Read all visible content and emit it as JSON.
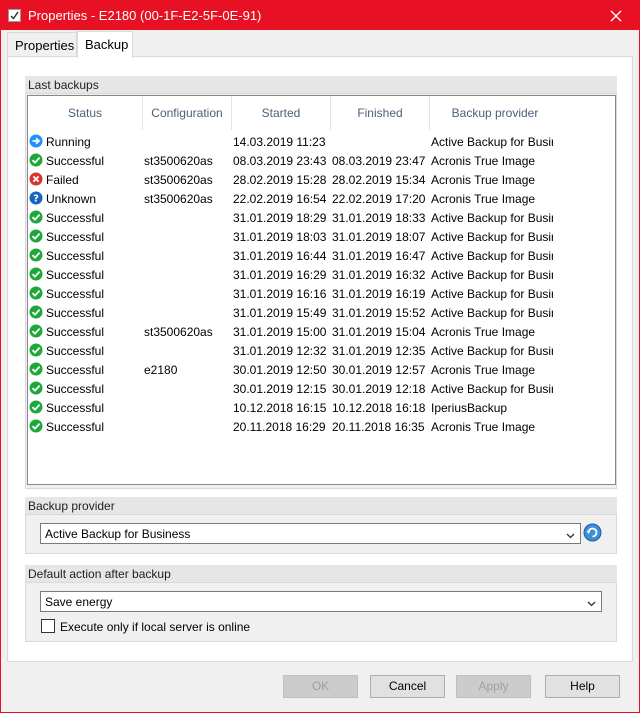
{
  "window": {
    "title": "Properties - E2180 (00-1F-E2-5F-0E-91)"
  },
  "tabs": [
    {
      "label": "Properties"
    },
    {
      "label": "Backup"
    }
  ],
  "last_backups": {
    "header": "Last backups",
    "columns": [
      "Status",
      "Configuration",
      "Started",
      "Finished",
      "Backup provider"
    ],
    "rows": [
      {
        "status": "Running",
        "status_icon": "running-icon",
        "config": "",
        "started": "14.03.2019 11:23",
        "finished": "",
        "provider": "Active Backup for Busine"
      },
      {
        "status": "Successful",
        "status_icon": "success-icon",
        "config": "st3500620as",
        "started": "08.03.2019 23:43",
        "finished": "08.03.2019 23:47",
        "provider": "Acronis True Image"
      },
      {
        "status": "Failed",
        "status_icon": "failed-icon",
        "config": "st3500620as",
        "started": "28.02.2019 15:28",
        "finished": "28.02.2019 15:34",
        "provider": "Acronis True Image"
      },
      {
        "status": "Unknown",
        "status_icon": "unknown-icon",
        "config": "st3500620as",
        "started": "22.02.2019 16:54",
        "finished": "22.02.2019 17:20",
        "provider": "Acronis True Image"
      },
      {
        "status": "Successful",
        "status_icon": "success-icon",
        "config": "",
        "started": "31.01.2019 18:29",
        "finished": "31.01.2019 18:33",
        "provider": "Active Backup for Busine"
      },
      {
        "status": "Successful",
        "status_icon": "success-icon",
        "config": "",
        "started": "31.01.2019 18:03",
        "finished": "31.01.2019 18:07",
        "provider": "Active Backup for Busine"
      },
      {
        "status": "Successful",
        "status_icon": "success-icon",
        "config": "",
        "started": "31.01.2019 16:44",
        "finished": "31.01.2019 16:47",
        "provider": "Active Backup for Busine"
      },
      {
        "status": "Successful",
        "status_icon": "success-icon",
        "config": "",
        "started": "31.01.2019 16:29",
        "finished": "31.01.2019 16:32",
        "provider": "Active Backup for Busine"
      },
      {
        "status": "Successful",
        "status_icon": "success-icon",
        "config": "",
        "started": "31.01.2019 16:16",
        "finished": "31.01.2019 16:19",
        "provider": "Active Backup for Busine"
      },
      {
        "status": "Successful",
        "status_icon": "success-icon",
        "config": "",
        "started": "31.01.2019 15:49",
        "finished": "31.01.2019 15:52",
        "provider": "Active Backup for Busine"
      },
      {
        "status": "Successful",
        "status_icon": "success-icon",
        "config": "st3500620as",
        "started": "31.01.2019 15:00",
        "finished": "31.01.2019 15:04",
        "provider": "Acronis True Image"
      },
      {
        "status": "Successful",
        "status_icon": "success-icon",
        "config": "",
        "started": "31.01.2019 12:32",
        "finished": "31.01.2019 12:35",
        "provider": "Active Backup for Busine"
      },
      {
        "status": "Successful",
        "status_icon": "success-icon",
        "config": "e2180",
        "started": "30.01.2019 12:50",
        "finished": "30.01.2019 12:57",
        "provider": "Acronis True Image"
      },
      {
        "status": "Successful",
        "status_icon": "success-icon",
        "config": "",
        "started": "30.01.2019 12:15",
        "finished": "30.01.2019 12:18",
        "provider": "Active Backup for Busine"
      },
      {
        "status": "Successful",
        "status_icon": "success-icon",
        "config": "",
        "started": "10.12.2018 16:15",
        "finished": "10.12.2018 16:18",
        "provider": "IperiusBackup"
      },
      {
        "status": "Successful",
        "status_icon": "success-icon",
        "config": "",
        "started": "20.11.2018 16:29",
        "finished": "20.11.2018 16:35",
        "provider": "Acronis True Image"
      }
    ]
  },
  "backup_provider": {
    "header": "Backup provider",
    "selected": "Active Backup for Business"
  },
  "default_action": {
    "header": "Default action after backup",
    "selected": "Save energy",
    "checkbox_label": "Execute only if local server is online",
    "checkbox_checked": false
  },
  "buttons": {
    "ok": "OK",
    "cancel": "Cancel",
    "apply": "Apply",
    "help": "Help"
  },
  "colors": {
    "titlebar": "#e81123",
    "success": "#1fa83a",
    "failed": "#d9342b",
    "running": "#1e90ff",
    "unknown": "#1565c0"
  }
}
